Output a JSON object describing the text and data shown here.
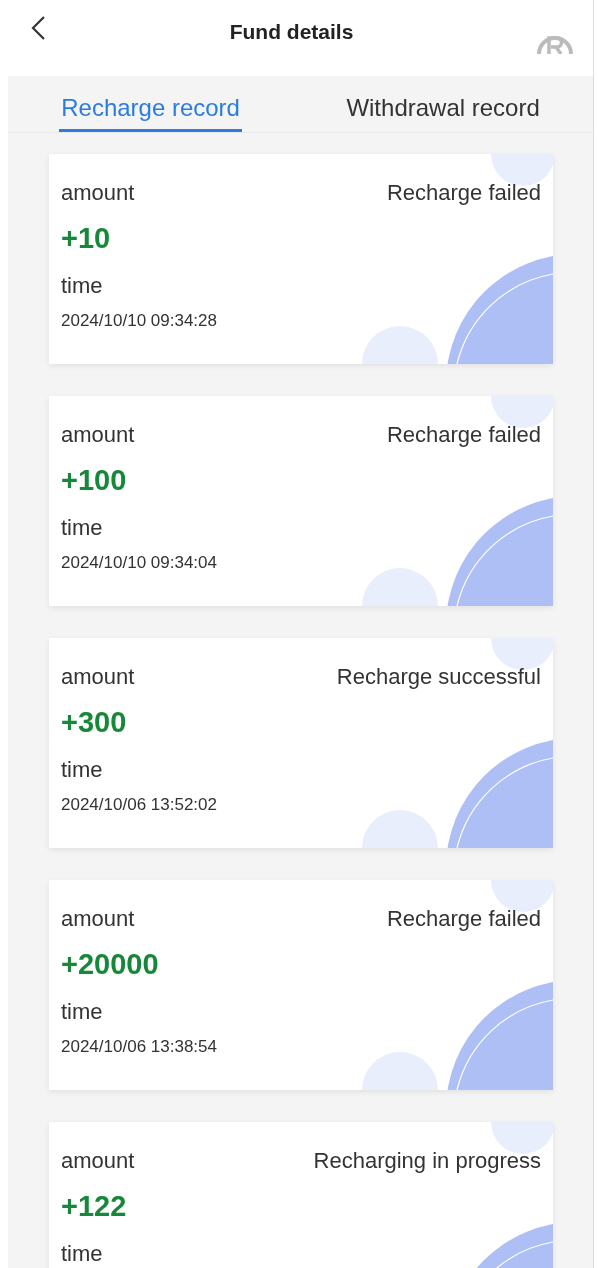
{
  "header": {
    "title": "Fund details"
  },
  "tabs": [
    {
      "label": "Recharge record",
      "selected": true
    },
    {
      "label": "Withdrawal record",
      "selected": false
    }
  ],
  "records": [
    {
      "amount_label": "amount",
      "status": "Recharge failed",
      "amount": "+10",
      "time_label": "time",
      "time": "2024/10/10 09:34:28"
    },
    {
      "amount_label": "amount",
      "status": "Recharge failed",
      "amount": "+100",
      "time_label": "time",
      "time": "2024/10/10 09:34:04"
    },
    {
      "amount_label": "amount",
      "status": "Recharge successful",
      "amount": "+300",
      "time_label": "time",
      "time": "2024/10/06 13:52:02"
    },
    {
      "amount_label": "amount",
      "status": "Recharge failed",
      "amount": "+20000",
      "time_label": "time",
      "time": "2024/10/06 13:38:54"
    },
    {
      "amount_label": "amount",
      "status": "Recharging in progress",
      "amount": "+122",
      "time_label": "time"
    }
  ]
}
